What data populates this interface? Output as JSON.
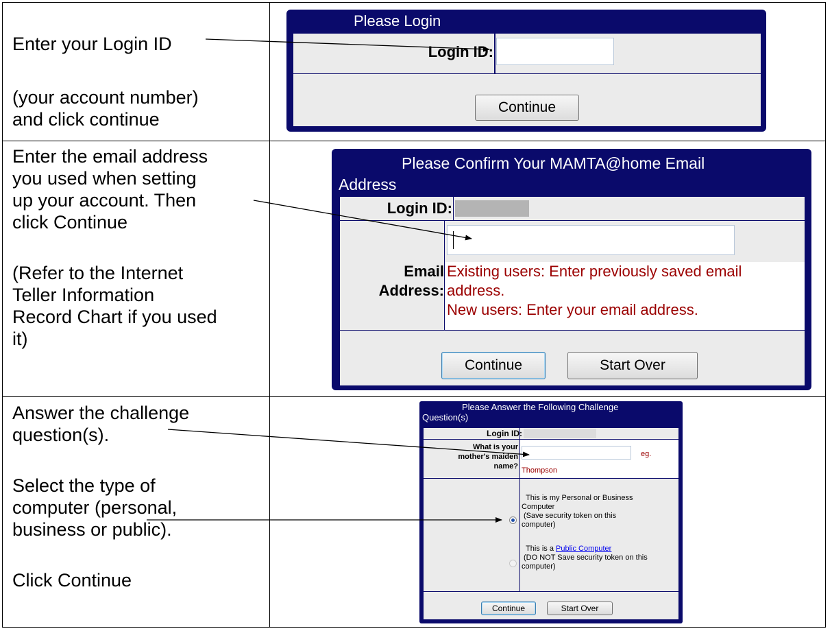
{
  "instructions": {
    "row1": {
      "line1": "Enter your Login ID",
      "line2": "(your account number)",
      "line3": "and click continue"
    },
    "row2": {
      "line1": "Enter the email address",
      "line2": "you used when setting",
      "line3": "up your account.  Then",
      "line4": "click Continue",
      "line5": "(Refer to the Internet",
      "line6": "Teller Information",
      "line7": "Record Chart if you used",
      "line8": "it)"
    },
    "row3": {
      "line1": "Answer the challenge",
      "line2": "question(s).",
      "line3": "Select the type of",
      "line4": "computer (personal,",
      "line5": "business or public).",
      "line6": "Click Continue"
    }
  },
  "login_panel": {
    "title": "Please Login",
    "login_id_label": "Login ID:",
    "login_id_value": "",
    "continue_label": "Continue"
  },
  "email_panel": {
    "title_line1": "Please Confirm Your MAMTA@home Email",
    "title_line2": "Address",
    "login_id_label": "Login ID:",
    "email_label_line1": "Email",
    "email_label_line2": "Address:",
    "email_value": "",
    "hint_line1": "Existing users: Enter previously saved email",
    "hint_line2": "address.",
    "hint_line3": "New users: Enter your email address.",
    "continue_label": "Continue",
    "start_over_label": "Start Over"
  },
  "challenge_panel": {
    "title_line1": "Please Answer the Following Challenge",
    "title_line2": "Question(s)",
    "login_id_label": "Login ID:",
    "question_line1": "What is your",
    "question_line2": "mother's maiden",
    "question_line3": "name?",
    "answer_value": "",
    "eg_label": "eg.",
    "eg_example": "Thompson",
    "option_personal_line1": "This is my Personal or Business",
    "option_personal_line2": "Computer",
    "option_personal_line3": "(Save security token on this",
    "option_personal_line4": "computer)",
    "option_public_prefix": "This is a ",
    "option_public_link": "Public Computer",
    "option_public_line2": "(DO NOT Save security token on this",
    "option_public_line3": "computer)",
    "selected_option": "personal",
    "continue_label": "Continue",
    "start_over_label": "Start Over"
  },
  "colors": {
    "panel_navy": "#0a0a6b",
    "row_gray": "#ebebeb",
    "hint_red": "#9b0000",
    "link_blue": "#0000ee"
  }
}
